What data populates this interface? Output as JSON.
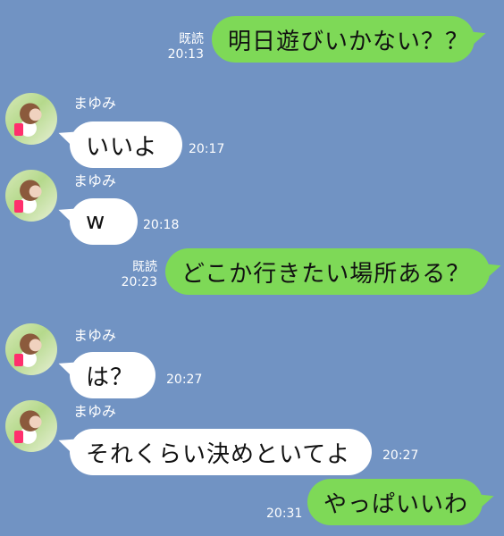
{
  "colors": {
    "background": "#7193c3",
    "sent_bubble": "#7ed957",
    "received_bubble": "#ffffff",
    "meta_text": "#ffffff"
  },
  "messages": [
    {
      "id": "m1",
      "side": "sent",
      "text": "明日遊びいかない？？",
      "read_label": "既読",
      "time": "20:13"
    },
    {
      "id": "m2",
      "side": "received",
      "sender": "まゆみ",
      "text": "いいよ",
      "time": "20:17"
    },
    {
      "id": "m3",
      "side": "received",
      "sender": "まゆみ",
      "text": "w",
      "time": "20:18"
    },
    {
      "id": "m4",
      "side": "sent",
      "text": "どこか行きたい場所ある？",
      "read_label": "既読",
      "time": "20:23"
    },
    {
      "id": "m5",
      "side": "received",
      "sender": "まゆみ",
      "text": "は？",
      "time": "20:27"
    },
    {
      "id": "m6",
      "side": "received",
      "sender": "まゆみ",
      "text": "それくらい決めといてよ",
      "time": "20:27"
    },
    {
      "id": "m7",
      "side": "sent",
      "text": "やっぱいいわ",
      "time": "20:31"
    }
  ]
}
